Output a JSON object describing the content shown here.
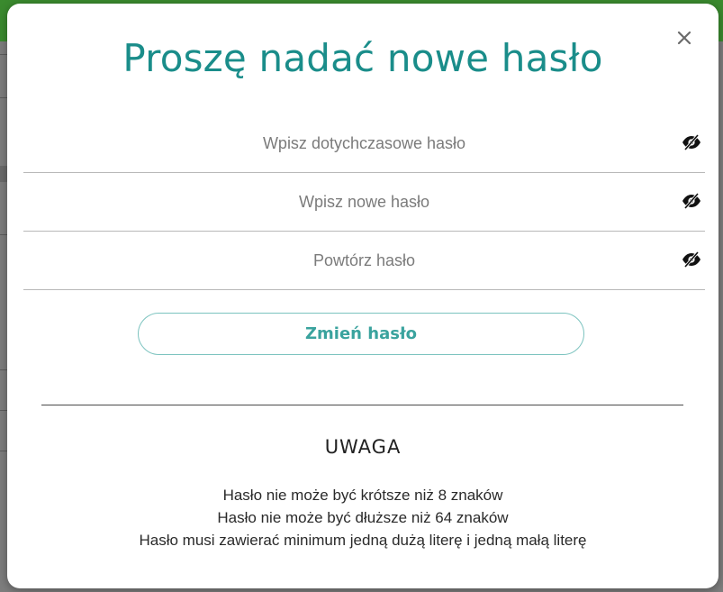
{
  "modal": {
    "title": "Proszę nadać nowe hasło",
    "close_icon": "close-icon",
    "accent_color": "#1a8d8a"
  },
  "form": {
    "current_password": {
      "placeholder": "Wpisz dotychczasowe hasło",
      "value": "",
      "icon": "eye-slash-icon"
    },
    "new_password": {
      "placeholder": "Wpisz nowe hasło",
      "value": "",
      "icon": "eye-slash-icon"
    },
    "repeat_password": {
      "placeholder": "Powtórz hasło",
      "value": "",
      "icon": "eye-slash-icon"
    },
    "submit_label": "Zmień hasło"
  },
  "notice": {
    "heading": "UWAGA",
    "rules": [
      "Hasło nie może być krótsze niż 8 znaków",
      "Hasło nie może być dłuższe niż 64 znaków",
      "Hasło musi zawierać minimum jedną dużą literę i jedną małą literę"
    ]
  }
}
